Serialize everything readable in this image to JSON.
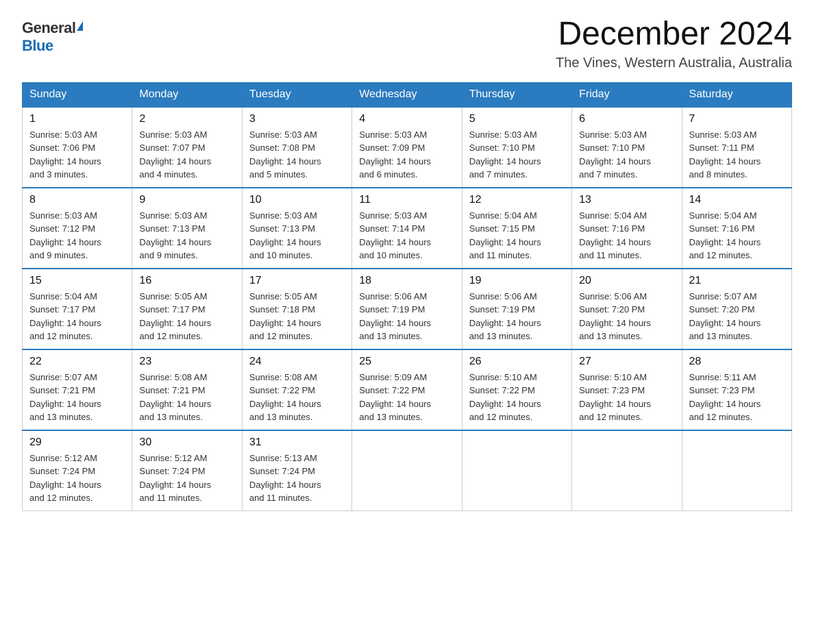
{
  "logo": {
    "general": "General",
    "blue": "Blue"
  },
  "title": "December 2024",
  "location": "The Vines, Western Australia, Australia",
  "days_of_week": [
    "Sunday",
    "Monday",
    "Tuesday",
    "Wednesday",
    "Thursday",
    "Friday",
    "Saturday"
  ],
  "weeks": [
    [
      {
        "day": "1",
        "sunrise": "5:03 AM",
        "sunset": "7:06 PM",
        "daylight": "14 hours and 3 minutes."
      },
      {
        "day": "2",
        "sunrise": "5:03 AM",
        "sunset": "7:07 PM",
        "daylight": "14 hours and 4 minutes."
      },
      {
        "day": "3",
        "sunrise": "5:03 AM",
        "sunset": "7:08 PM",
        "daylight": "14 hours and 5 minutes."
      },
      {
        "day": "4",
        "sunrise": "5:03 AM",
        "sunset": "7:09 PM",
        "daylight": "14 hours and 6 minutes."
      },
      {
        "day": "5",
        "sunrise": "5:03 AM",
        "sunset": "7:10 PM",
        "daylight": "14 hours and 7 minutes."
      },
      {
        "day": "6",
        "sunrise": "5:03 AM",
        "sunset": "7:10 PM",
        "daylight": "14 hours and 7 minutes."
      },
      {
        "day": "7",
        "sunrise": "5:03 AM",
        "sunset": "7:11 PM",
        "daylight": "14 hours and 8 minutes."
      }
    ],
    [
      {
        "day": "8",
        "sunrise": "5:03 AM",
        "sunset": "7:12 PM",
        "daylight": "14 hours and 9 minutes."
      },
      {
        "day": "9",
        "sunrise": "5:03 AM",
        "sunset": "7:13 PM",
        "daylight": "14 hours and 9 minutes."
      },
      {
        "day": "10",
        "sunrise": "5:03 AM",
        "sunset": "7:13 PM",
        "daylight": "14 hours and 10 minutes."
      },
      {
        "day": "11",
        "sunrise": "5:03 AM",
        "sunset": "7:14 PM",
        "daylight": "14 hours and 10 minutes."
      },
      {
        "day": "12",
        "sunrise": "5:04 AM",
        "sunset": "7:15 PM",
        "daylight": "14 hours and 11 minutes."
      },
      {
        "day": "13",
        "sunrise": "5:04 AM",
        "sunset": "7:16 PM",
        "daylight": "14 hours and 11 minutes."
      },
      {
        "day": "14",
        "sunrise": "5:04 AM",
        "sunset": "7:16 PM",
        "daylight": "14 hours and 12 minutes."
      }
    ],
    [
      {
        "day": "15",
        "sunrise": "5:04 AM",
        "sunset": "7:17 PM",
        "daylight": "14 hours and 12 minutes."
      },
      {
        "day": "16",
        "sunrise": "5:05 AM",
        "sunset": "7:17 PM",
        "daylight": "14 hours and 12 minutes."
      },
      {
        "day": "17",
        "sunrise": "5:05 AM",
        "sunset": "7:18 PM",
        "daylight": "14 hours and 12 minutes."
      },
      {
        "day": "18",
        "sunrise": "5:06 AM",
        "sunset": "7:19 PM",
        "daylight": "14 hours and 13 minutes."
      },
      {
        "day": "19",
        "sunrise": "5:06 AM",
        "sunset": "7:19 PM",
        "daylight": "14 hours and 13 minutes."
      },
      {
        "day": "20",
        "sunrise": "5:06 AM",
        "sunset": "7:20 PM",
        "daylight": "14 hours and 13 minutes."
      },
      {
        "day": "21",
        "sunrise": "5:07 AM",
        "sunset": "7:20 PM",
        "daylight": "14 hours and 13 minutes."
      }
    ],
    [
      {
        "day": "22",
        "sunrise": "5:07 AM",
        "sunset": "7:21 PM",
        "daylight": "14 hours and 13 minutes."
      },
      {
        "day": "23",
        "sunrise": "5:08 AM",
        "sunset": "7:21 PM",
        "daylight": "14 hours and 13 minutes."
      },
      {
        "day": "24",
        "sunrise": "5:08 AM",
        "sunset": "7:22 PM",
        "daylight": "14 hours and 13 minutes."
      },
      {
        "day": "25",
        "sunrise": "5:09 AM",
        "sunset": "7:22 PM",
        "daylight": "14 hours and 13 minutes."
      },
      {
        "day": "26",
        "sunrise": "5:10 AM",
        "sunset": "7:22 PM",
        "daylight": "14 hours and 12 minutes."
      },
      {
        "day": "27",
        "sunrise": "5:10 AM",
        "sunset": "7:23 PM",
        "daylight": "14 hours and 12 minutes."
      },
      {
        "day": "28",
        "sunrise": "5:11 AM",
        "sunset": "7:23 PM",
        "daylight": "14 hours and 12 minutes."
      }
    ],
    [
      {
        "day": "29",
        "sunrise": "5:12 AM",
        "sunset": "7:24 PM",
        "daylight": "14 hours and 12 minutes."
      },
      {
        "day": "30",
        "sunrise": "5:12 AM",
        "sunset": "7:24 PM",
        "daylight": "14 hours and 11 minutes."
      },
      {
        "day": "31",
        "sunrise": "5:13 AM",
        "sunset": "7:24 PM",
        "daylight": "14 hours and 11 minutes."
      },
      null,
      null,
      null,
      null
    ]
  ],
  "labels": {
    "sunrise": "Sunrise:",
    "sunset": "Sunset:",
    "daylight": "Daylight:"
  }
}
